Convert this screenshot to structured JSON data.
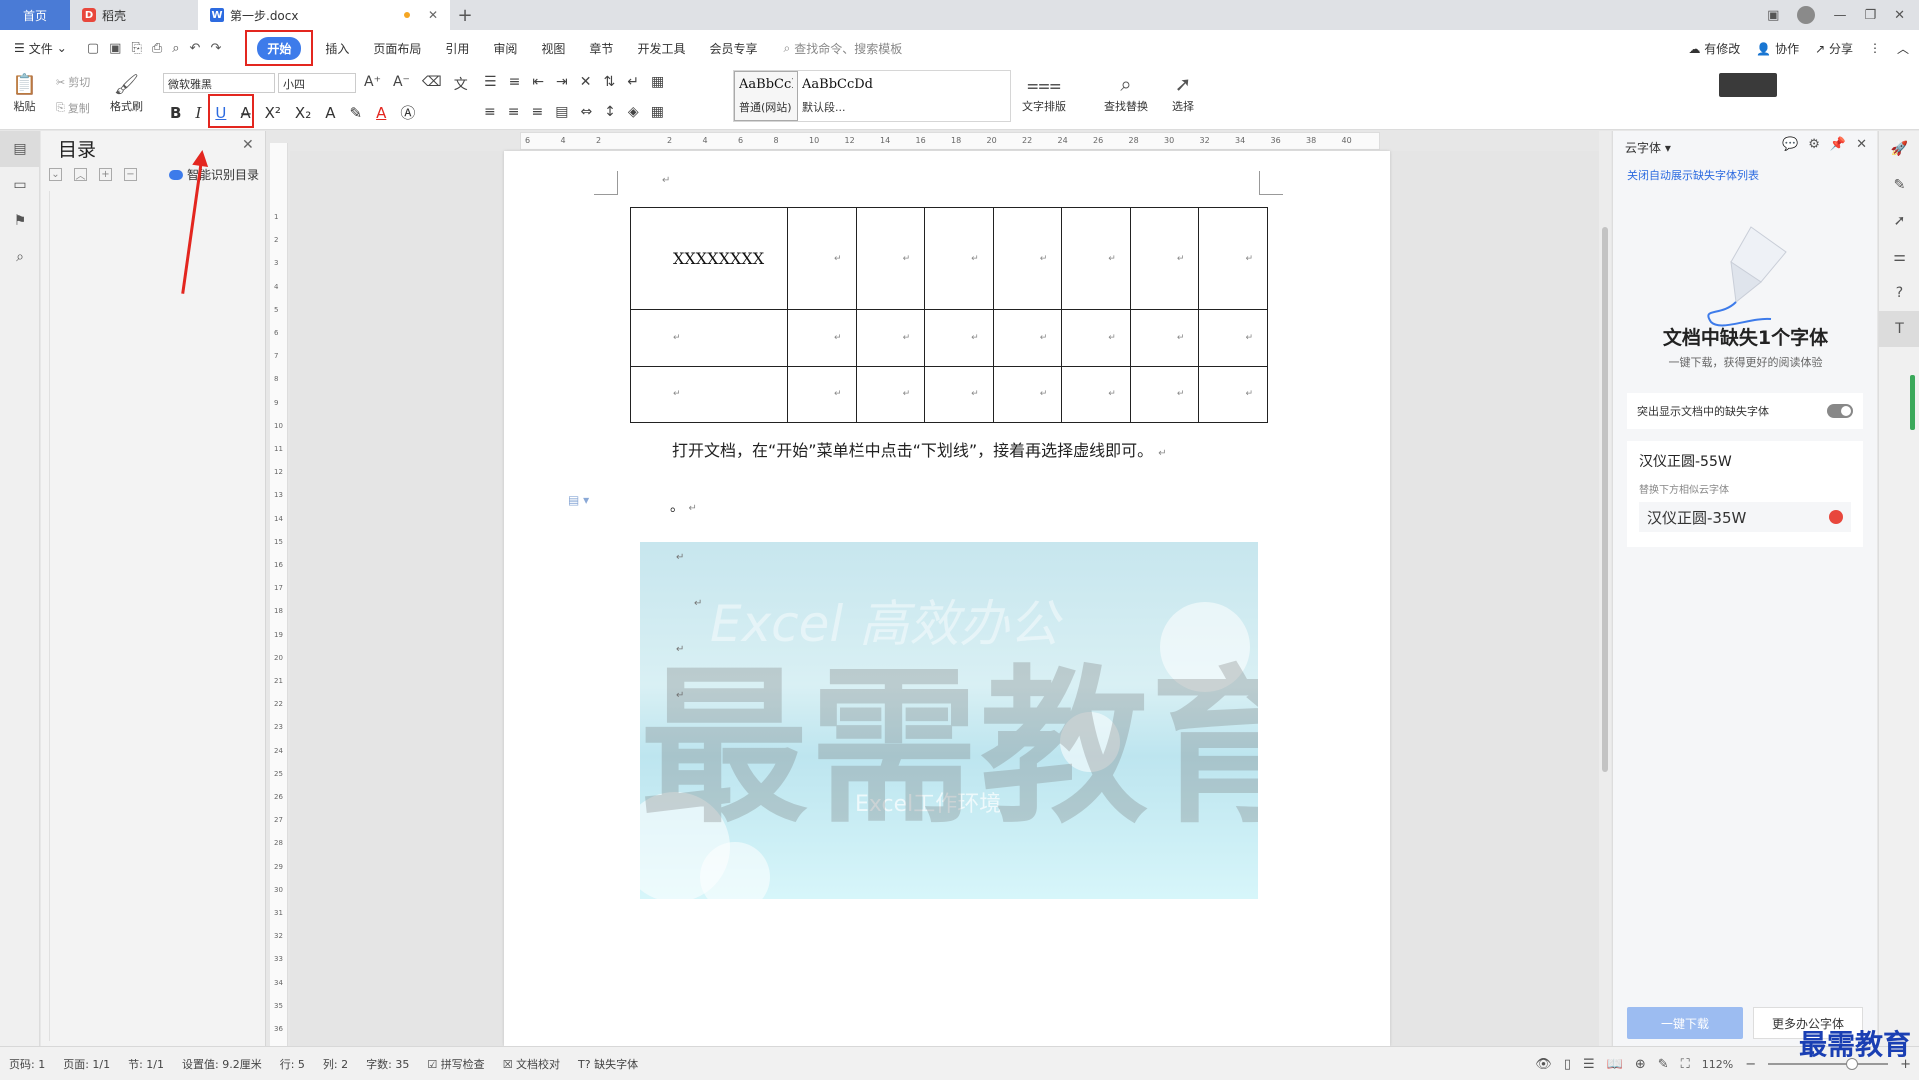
{
  "tabs": {
    "home": "首页",
    "daoke": "稻壳",
    "doc": "第一步.docx",
    "add": "+"
  },
  "menu": {
    "file": "文件",
    "start": "开始",
    "items": [
      "插入",
      "页面布局",
      "引用",
      "审阅",
      "视图",
      "章节",
      "开发工具",
      "会员专享"
    ],
    "search_placeholder": "查找命令、搜索模板",
    "right": [
      "有修改",
      "协作",
      "分享"
    ]
  },
  "ribbon": {
    "paste": "粘贴",
    "cut": "剪切",
    "copy": "复制",
    "format_painter": "格式刷",
    "font_name": "微软雅黑",
    "font_size": "小四",
    "style_normal_preview": "AaBbCcI",
    "style_normal_label": "普通(网站)",
    "style_default_preview": "AaBbCcDd",
    "style_default_label": "默认段...",
    "text_layout": "文字排版",
    "find_replace": "查找替换",
    "select": "选择"
  },
  "toc": {
    "title": "目录",
    "smart": "智能识别目录"
  },
  "document": {
    "cell_text": "XXXXXXXX",
    "body_text": "打开文档，在“开始”菜单栏中点击“下划线”，接着再选择虚线即可。",
    "dot": "。",
    "image_watermark": "最需教育",
    "image_title": "Excel 高效办公",
    "image_subtitle": "Excel工作环境",
    "table_rows": 3,
    "table_cols": 8
  },
  "ruler": {
    "h_ticks": [
      "6",
      "4",
      "2",
      "",
      "2",
      "4",
      "6",
      "8",
      "10",
      "12",
      "14",
      "16",
      "18",
      "20",
      "22",
      "24",
      "26",
      "28",
      "30",
      "32",
      "34",
      "36",
      "38",
      "40"
    ],
    "v_ticks": [
      "1",
      "2",
      "3",
      "4",
      "5",
      "6",
      "7",
      "8",
      "9",
      "10",
      "11",
      "12",
      "13",
      "14",
      "15",
      "16",
      "17",
      "18",
      "19",
      "20",
      "21",
      "22",
      "23",
      "24",
      "25",
      "26",
      "27",
      "28",
      "29",
      "30",
      "31",
      "32",
      "33",
      "34",
      "35",
      "36"
    ]
  },
  "cloud_font": {
    "header": "云字体",
    "link": "关闭自动展示缺失字体列表",
    "title": "文档中缺失1个字体",
    "subtitle": "一键下载，获得更好的阅读体验",
    "toggle_label": "突出显示文档中的缺失字体",
    "missing_font": "汉仪正圆-55W",
    "replace_hint": "替换下方相似云字体",
    "similar_font": "汉仪正圆-35W",
    "btn_download": "一键下载",
    "btn_more": "更多办公字体"
  },
  "status": {
    "page_no": "页码: 1",
    "page": "页面: 1/1",
    "section": "节: 1/1",
    "setting": "设置值: 9.2厘米",
    "row": "行: 5",
    "col": "列: 2",
    "words": "字数: 35",
    "spell": "拼写检查",
    "proof": "文档校对",
    "missing_font": "缺失字体",
    "zoom": "112%",
    "brand": "最需教育"
  },
  "colors": {
    "accent": "#3d7bea",
    "highlight": "#e3261f"
  }
}
